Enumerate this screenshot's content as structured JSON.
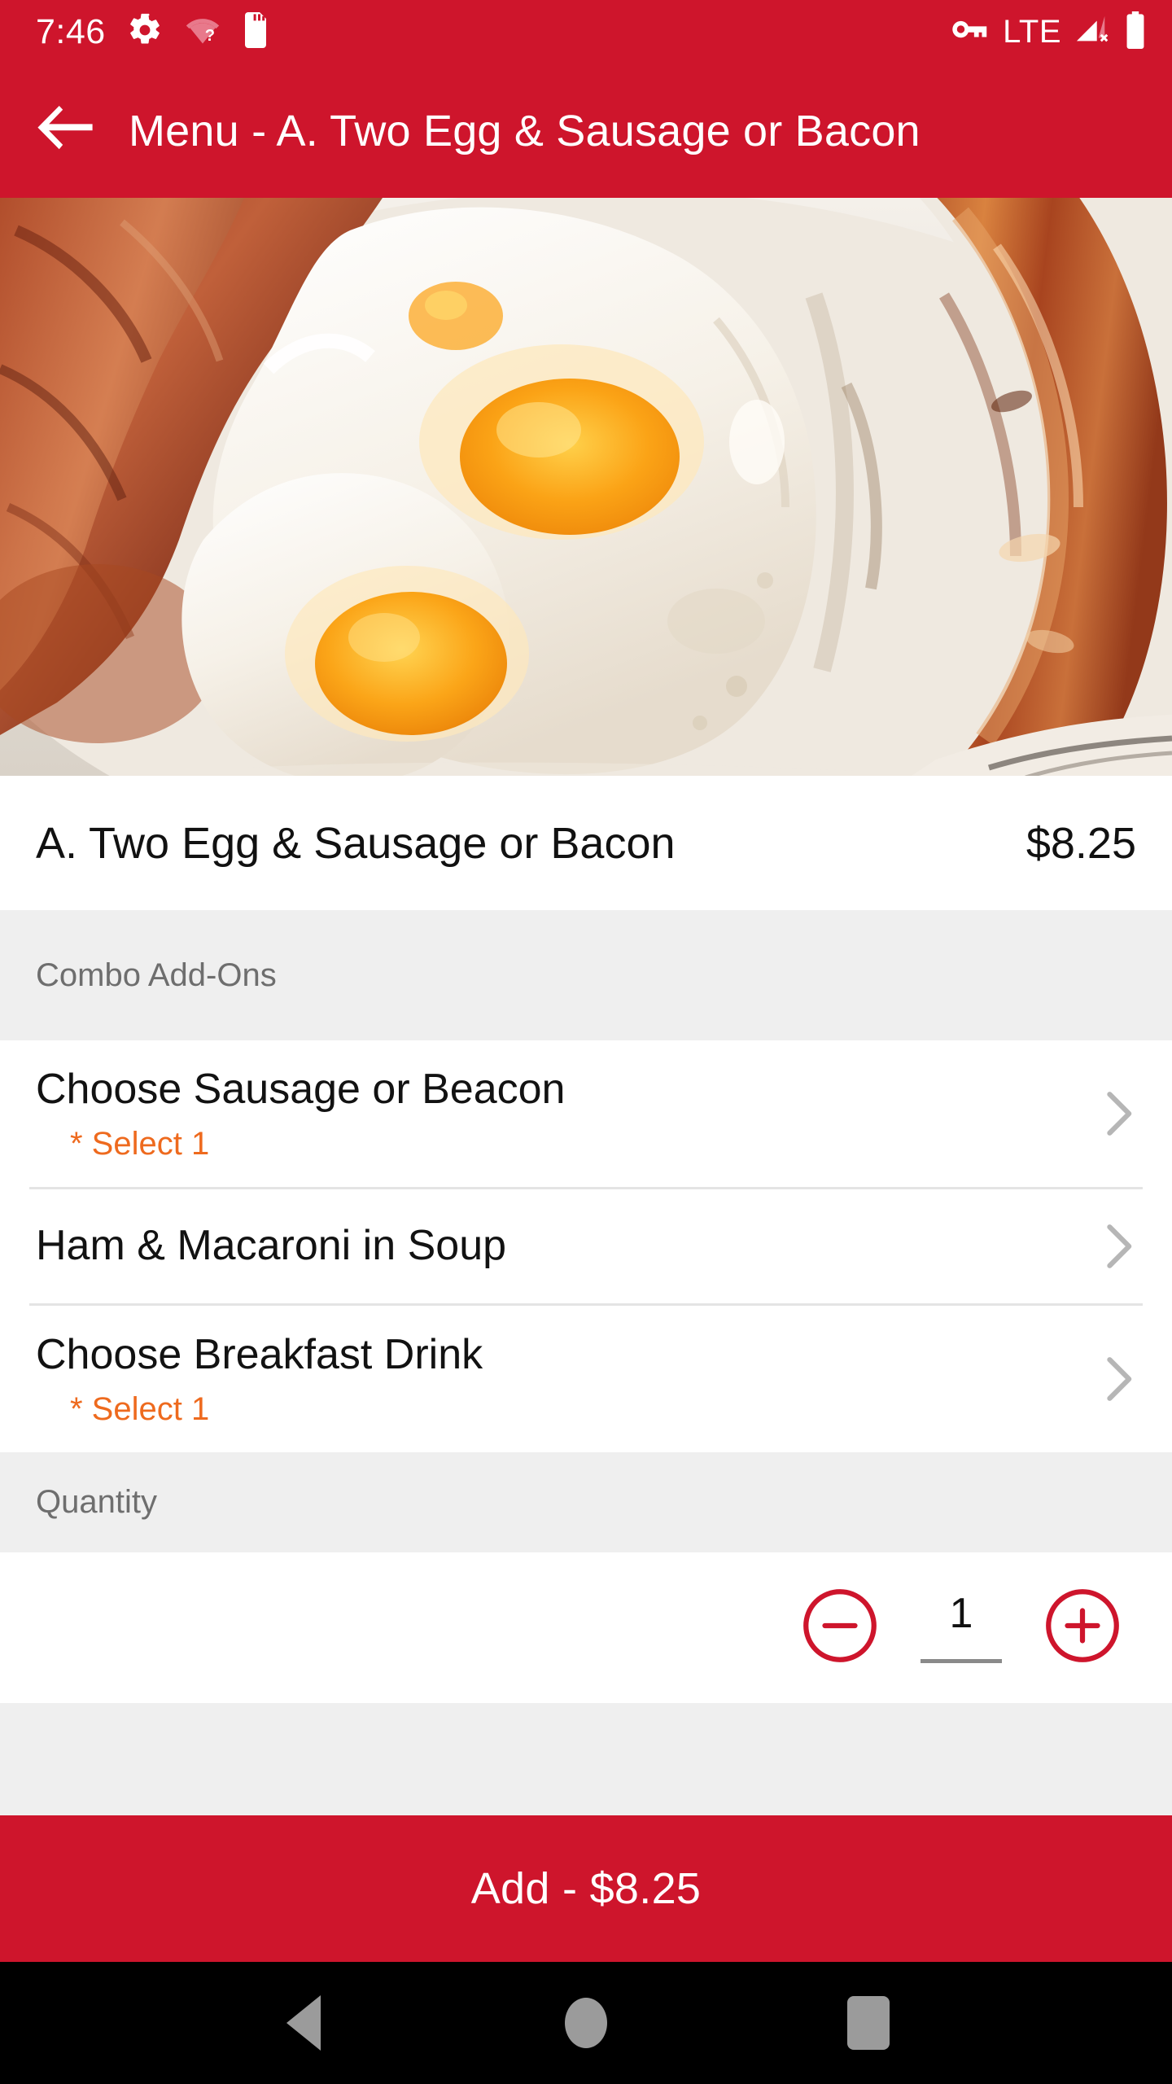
{
  "status_bar": {
    "time": "7:46",
    "icons_left": [
      "gear-icon",
      "wifi-no-connection-icon",
      "sd-card-icon"
    ],
    "network_label": "LTE",
    "icons_right": [
      "vpn-key-icon",
      "cellular-signal-off-icon",
      "battery-full-icon"
    ]
  },
  "app_bar": {
    "back_icon": "arrow-back-icon",
    "title": "Menu - A. Two Egg & Sausage or Bacon"
  },
  "hero": {
    "alt": "Plate with two fried eggs, bacon strips and a grilled sausage"
  },
  "item": {
    "name": "A. Two Egg & Sausage or Bacon",
    "price": "$8.25"
  },
  "combo": {
    "section_title": "Combo Add-Ons",
    "options": [
      {
        "title": "Choose Sausage or Beacon",
        "requirement": "* Select 1",
        "chevron": "chevron-right-icon"
      },
      {
        "title": "Ham & Macaroni in Soup",
        "requirement": "",
        "chevron": "chevron-right-icon"
      },
      {
        "title": "Choose Breakfast Drink",
        "requirement": "* Select 1",
        "chevron": "chevron-right-icon"
      }
    ]
  },
  "quantity": {
    "section_title": "Quantity",
    "value": "1",
    "decrement_icon": "minus-circle-icon",
    "increment_icon": "plus-circle-icon"
  },
  "footer": {
    "add_label": "Add - $8.25"
  },
  "nav_bar": {
    "back": "nav-back-triangle-icon",
    "home": "nav-home-circle-icon",
    "recents": "nav-recents-square-icon"
  },
  "colors": {
    "brand_red": "#ce152c",
    "accent_orange": "#ee6a1e",
    "section_gray": "#efefef",
    "text_gray": "#6e6e6e",
    "chevron_gray": "#b6b6b6"
  }
}
